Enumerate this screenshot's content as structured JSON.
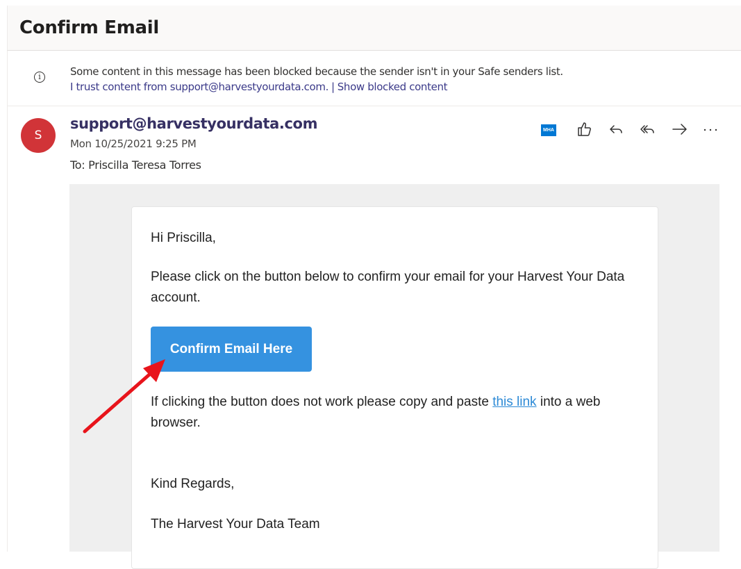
{
  "window": {
    "title": "Confirm Email"
  },
  "notice": {
    "icon": "info-icon",
    "message": "Some content in this message has been blocked because the sender isn't in your Safe senders list.",
    "trust_link": "I trust content from support@harvestyourdata.com.",
    "separator": "|",
    "show_blocked_link": "Show blocked content"
  },
  "message": {
    "avatar_initial": "S",
    "avatar_color": "#d13438",
    "sender": "support@harvestyourdata.com",
    "date": "Mon 10/25/2021 9:25 PM",
    "to": "To:  Priscilla Teresa Torres"
  },
  "toolbar": {
    "addin_label": "MHA",
    "icons": [
      "like-icon",
      "reply-icon",
      "reply-all-icon",
      "forward-icon",
      "more-icon"
    ]
  },
  "email_body": {
    "greeting": "Hi Priscilla,",
    "paragraph1": "Please click on the button below to confirm your email for your Harvest Your Data account.",
    "button_label": "Confirm Email Here",
    "button_color": "#3592e0",
    "paragraph2_before": "If clicking the button does not work please copy and paste ",
    "paragraph2_link": "this link",
    "paragraph2_after": " into a web browser.",
    "closing": "Kind Regards,",
    "signature": "The Harvest Your Data Team"
  },
  "annotation": {
    "arrow_color": "#e8141b"
  }
}
